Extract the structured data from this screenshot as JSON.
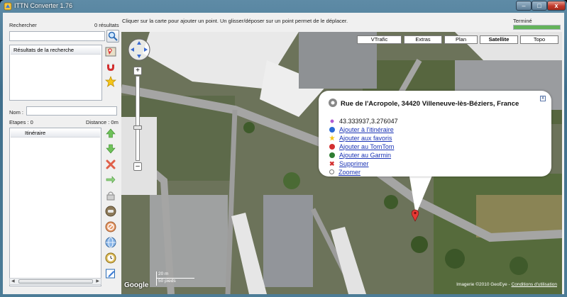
{
  "window": {
    "title": "ITTN Converter 1.76"
  },
  "search": {
    "label": "Rechercher",
    "count": "0 résultats",
    "input_value": "",
    "results_header": "Résultats de la recherche"
  },
  "route": {
    "name_label": "Nom :",
    "name_value": "",
    "stages_label": "Etapes : 0",
    "distance_label": "Distance : 0m",
    "list_header": "Itinéraire"
  },
  "hint": "Cliquer sur la carte pour ajouter un point. Un glisser/déposer sur un point permet de le déplacer.",
  "status": {
    "text": "Terminé",
    "progress": 1.0
  },
  "map": {
    "tabs": [
      "VTrafic",
      "Extras",
      "Plan",
      "Satellite",
      "Topo"
    ],
    "active_tab": "Satellite",
    "scale": {
      "metric": "20 m",
      "imperial": "50 pieds"
    },
    "logo": "Google",
    "copyright": "Imagerie ©2010 GeoEye -",
    "terms_link": "Conditions d'utilisation"
  },
  "popup": {
    "address": "Rue de l'Acropole, 34420 Villeneuve-lès-Béziers, France",
    "coords": "43.333937,3.276047",
    "actions": [
      "Ajouter à l'itinéraire",
      "Ajouter aux favoris",
      "Ajouter au TomTom",
      "Ajouter au Garmin",
      "Supprimer",
      "Zoomer"
    ],
    "close_glyph": "x"
  },
  "colors": {
    "accent_link": "#1a33b5",
    "marker": "#e53935",
    "progress": "#63b35a"
  }
}
